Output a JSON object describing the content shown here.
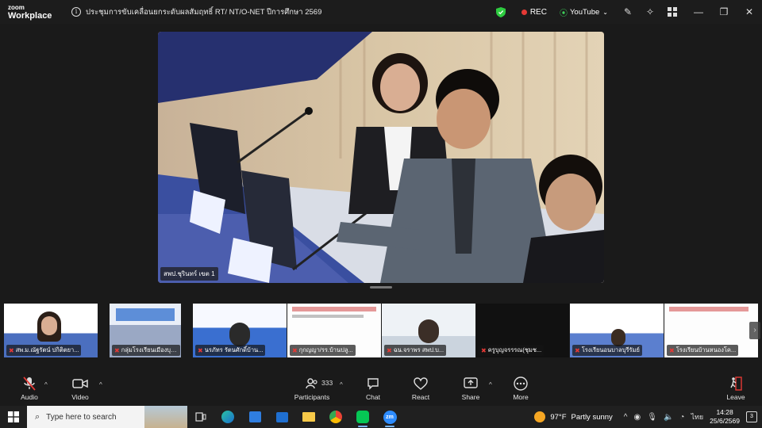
{
  "app": {
    "logo_top": "zoom",
    "logo_bottom": "Workplace",
    "meeting_title": "ประชุมการขับเคลื่อนยกระดับผลสัมฤทธิ์ RT/ NT/O-NET ปีการศึกษา 2569",
    "rec_label": "REC",
    "stream_label": "YouTube"
  },
  "main_video": {
    "speaker_name": "สพป.ชุรินทร์ เขต 1"
  },
  "thumbnails": [
    {
      "name": "สพ.ม.ณัฐรัตน์ ปกิติตยา..."
    },
    {
      "name": "กลุ่มโรงเรียนเมืองบุรีรั..."
    },
    {
      "name": "นรภัทร รัตนศักดิ์บ้าน..."
    },
    {
      "name": "กุกญญา/รร.บ้านปลู..."
    },
    {
      "name": "ฉน.จราพร สพป.บ..."
    },
    {
      "name": "ครูบุญจรรรณ(ชุมช..."
    },
    {
      "name": "โรงเรียนอนบาลบุรีรัมย์"
    },
    {
      "name": "โรงเรียนบ้านหนองโค..."
    }
  ],
  "toolbar": {
    "audio": "Audio",
    "video": "Video",
    "participants": "Participants",
    "participants_count": "333",
    "chat": "Chat",
    "react": "React",
    "share": "Share",
    "more": "More",
    "leave": "Leave"
  },
  "taskbar": {
    "search_placeholder": "Type here to search",
    "temperature": "97°F",
    "weather": "Partly sunny",
    "language": "ไทย",
    "time": "14:28",
    "date": "25/6/2569",
    "notifications": "3"
  }
}
